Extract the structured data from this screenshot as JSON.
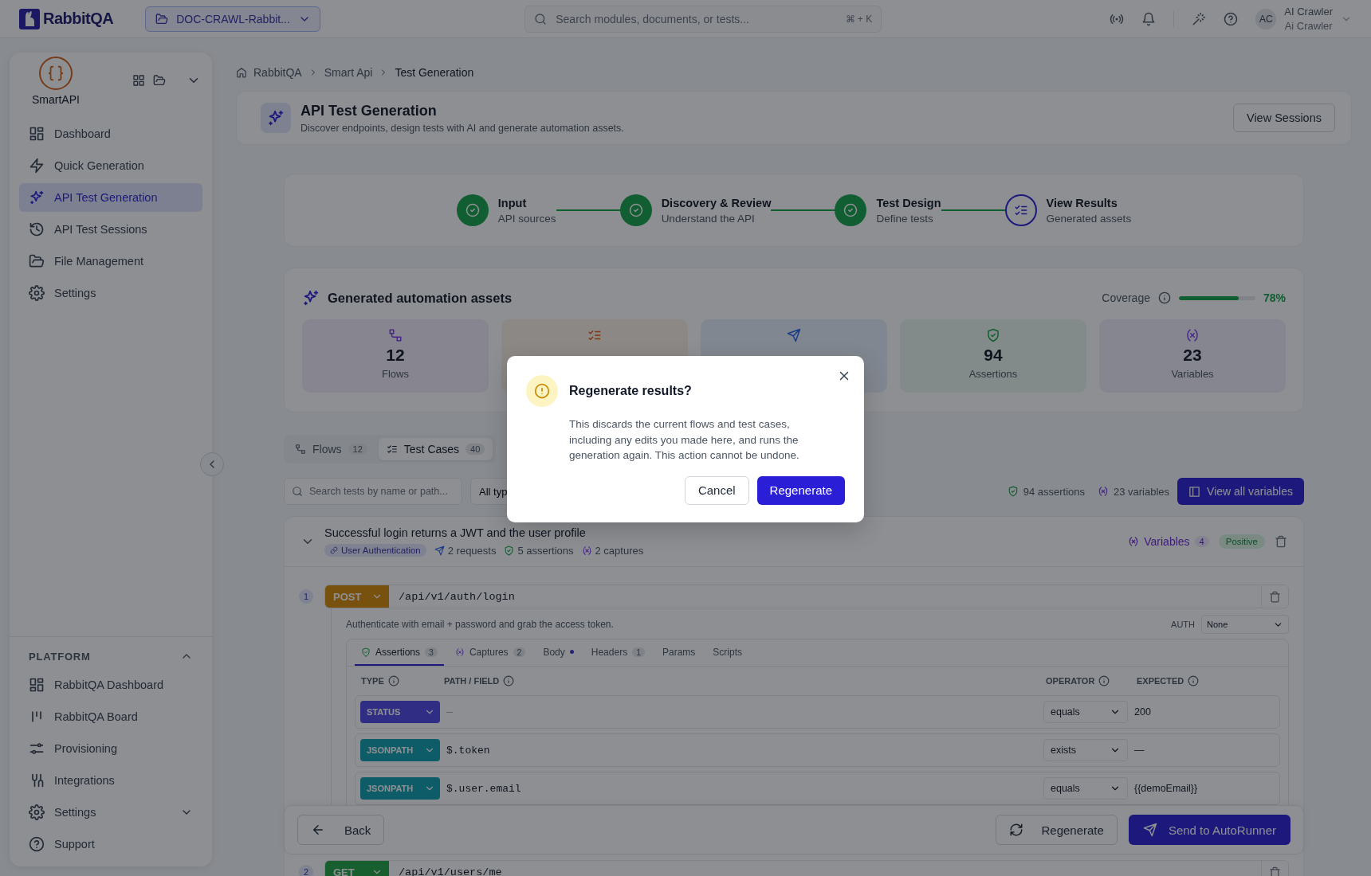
{
  "topbar": {
    "logo": "RabbitQA",
    "project": "DOC-CRAWL-Rabbit...",
    "search": {
      "placeholder": "Search modules, documents, or tests..."
    },
    "shortcut": "⌘ + K",
    "user": {
      "initials": "AC",
      "name": "AI Crawler",
      "role": "Ai Crawler"
    }
  },
  "sidebar": {
    "app": "SmartAPI",
    "items": [
      {
        "label": "Dashboard",
        "selected": false
      },
      {
        "label": "Quick Generation",
        "selected": false
      },
      {
        "label": "API Test Generation",
        "selected": true
      },
      {
        "label": "API Test Sessions",
        "selected": false
      },
      {
        "label": "File Management",
        "selected": false
      },
      {
        "label": "Settings",
        "selected": false
      }
    ],
    "platform": {
      "title": "PLATFORM",
      "expanded": true,
      "items": [
        {
          "label": "RabbitQA Dashboard",
          "kind": "link"
        },
        {
          "label": "RabbitQA Board",
          "kind": "link"
        },
        {
          "label": "Provisioning",
          "kind": "link"
        },
        {
          "label": "Integrations",
          "kind": "link"
        },
        {
          "label": "Settings",
          "kind": "group"
        },
        {
          "label": "Support",
          "kind": "link"
        }
      ]
    }
  },
  "breadcrumb": [
    "RabbitQA",
    "Smart Api",
    "Test Generation"
  ],
  "header": {
    "title": "API Test Generation",
    "subtitle": "Discover endpoints, design tests with AI and generate automation assets.",
    "button": "View Sessions"
  },
  "steps": [
    {
      "title": "Input",
      "subtitle": "API sources",
      "completed": true
    },
    {
      "title": "Discovery & Review",
      "subtitle": "Understand the API",
      "completed": true
    },
    {
      "title": "Test Design",
      "subtitle": "Define tests",
      "completed": true
    },
    {
      "title": "View Results",
      "subtitle": "Generated assets",
      "completed": false
    }
  ],
  "assets": {
    "title": "Generated automation assets",
    "coverage": {
      "label": "Coverage",
      "level": 0.78,
      "reading": "78%"
    },
    "stats": [
      {
        "kind": "flows",
        "value": "12",
        "label": "Flows"
      },
      {
        "kind": "test-cases"
      },
      {
        "kind": "requests"
      },
      {
        "kind": "assertions",
        "value": "94",
        "label": "Assertions"
      },
      {
        "kind": "variables",
        "value": "23",
        "label": "Variables"
      }
    ]
  },
  "view_tabs": [
    {
      "label": "Flows",
      "count": "12",
      "selected": false
    },
    {
      "label": "Test Cases",
      "count": "40",
      "selected": true
    }
  ],
  "filters": {
    "search": {
      "placeholder": "Search tests by name or path..."
    },
    "type_filter": "All typ",
    "assertions": "94 assertions",
    "variables": "23 variables",
    "button": "View all variables"
  },
  "test_case": {
    "title": "Successful login returns a JWT and the user profile",
    "expanded": true,
    "flow": "User Authentication",
    "requests": "2 requests",
    "assertions": "5 assertions",
    "captures": "2 captures",
    "variables": {
      "label": "Variables",
      "count": "4"
    },
    "type": "Positive",
    "steps": [
      {
        "number": "1",
        "method": "POST",
        "kind": "post",
        "path": "/api/v1/auth/login",
        "description": "Authenticate with email + password and grab the access token.",
        "auth": {
          "label": "AUTH",
          "value": "None"
        },
        "tabs": [
          {
            "label": "Assertions",
            "count": "3",
            "modified": false,
            "selected": true
          },
          {
            "label": "Captures",
            "count": "2",
            "modified": false,
            "selected": false
          },
          {
            "label": "Body",
            "modified": true,
            "selected": false
          },
          {
            "label": "Headers",
            "count": "1",
            "modified": false,
            "selected": false
          },
          {
            "label": "Params",
            "modified": false,
            "selected": false
          },
          {
            "label": "Scripts",
            "modified": false,
            "selected": false
          }
        ],
        "columns": [
          "TYPE",
          "PATH / FIELD",
          "OPERATOR",
          "EXPECTED"
        ],
        "assertions": [
          {
            "type": "STATUS",
            "kind": "status",
            "path": "—",
            "operator": "equals",
            "expected": "200"
          },
          {
            "type": "JSONPATH",
            "kind": "jsonpath",
            "path": "$.token",
            "operator": "exists",
            "expected": "—"
          },
          {
            "type": "JSONPATH",
            "kind": "jsonpath",
            "path": "$.user.email",
            "operator": "equals",
            "expected": "{{demoEmail}}"
          }
        ]
      },
      {
        "number": "2",
        "method": "GET",
        "kind": "get",
        "path": "/api/v1/users/me"
      }
    ]
  },
  "actions": {
    "back": "Back",
    "regenerate": "Regenerate",
    "send": "Send to AutoRunner"
  },
  "dialog": {
    "title": "Regenerate results?",
    "message": "This discards the current flows and test cases, including any edits you made here, and runs the generation again. This action cannot be undone.",
    "cancel": "Cancel",
    "confirm": "Regenerate"
  }
}
